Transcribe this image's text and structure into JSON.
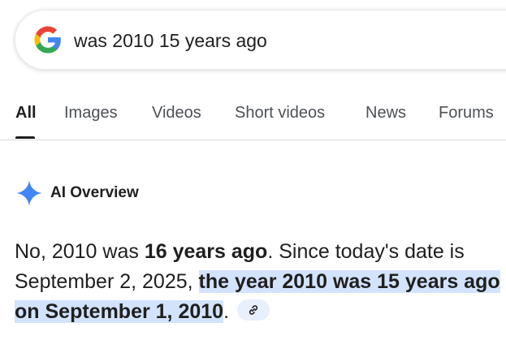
{
  "search": {
    "query": "was 2010 15 years ago"
  },
  "tabs": [
    {
      "label": "All",
      "active": true
    },
    {
      "label": "Images",
      "active": false
    },
    {
      "label": "Videos",
      "active": false
    },
    {
      "label": "Short videos",
      "active": false
    },
    {
      "label": "News",
      "active": false
    },
    {
      "label": "Forums",
      "active": false
    }
  ],
  "ai_overview": {
    "title": "AI Overview",
    "answer": {
      "part1": "No, 2010 was ",
      "bold1": "16 years ago",
      "part2": ". Since today's date is September 2, 2025, ",
      "highlight": "the year 2010 was 15 years ago on September 1, 2010",
      "part3": "."
    }
  },
  "icons": {
    "logo": "google-g-logo",
    "sparkle": "gemini-sparkle-icon",
    "link": "link-icon"
  },
  "colors": {
    "highlight": "#d3e3fd",
    "sparkle": "#4285f4",
    "chip": "#e8f0fe"
  }
}
